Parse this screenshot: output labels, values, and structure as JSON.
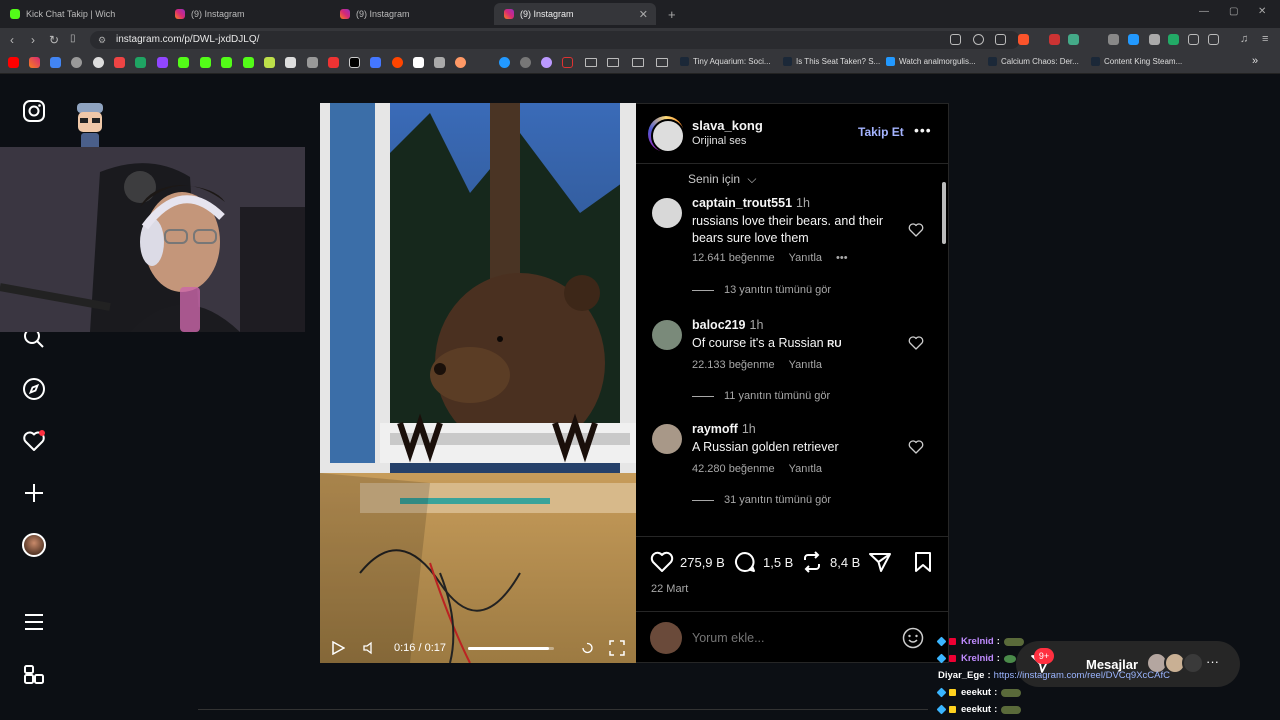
{
  "browser": {
    "tabs": [
      {
        "label": "Kick Chat Takip | Wich",
        "active": false
      },
      {
        "label": "(9) Instagram",
        "active": false
      },
      {
        "label": "(9) Instagram",
        "active": false
      },
      {
        "label": "(9) Instagram",
        "active": true
      }
    ],
    "new_tab": "+",
    "url": "instagram.com/p/DWL-jxdDJLQ/",
    "bookmarks": [
      "Tiny Aquarium: Soci...",
      "Is This Seat Taken? S...",
      "Watch analmorgulis...",
      "Calcium Chaos: Der...",
      "Content King Steam..."
    ],
    "bookmarks_more": "»"
  },
  "post": {
    "username": "slava_kong",
    "audio": "Orijinal ses",
    "follow_label": "Takip Et",
    "more": "•••",
    "sort_label": "Senin için",
    "comments": [
      {
        "user": "captain_trout551",
        "time": "1h",
        "text": "russians love their bears. and their bears sure love them",
        "likes": "12.641 beğenme",
        "reply": "Yanıtla",
        "more": "•••",
        "replies": "13 yanıtın tümünü gör"
      },
      {
        "user": "baloc219",
        "time": "1h",
        "text": "Of course it's a Russian",
        "flag": "RU",
        "likes": "22.133 beğenme",
        "reply": "Yanıtla",
        "replies": "11 yanıtın tümünü gör"
      },
      {
        "user": "raymoff",
        "time": "1h",
        "text": "A Russian golden retriever",
        "likes": "42.280 beğenme",
        "reply": "Yanıtla",
        "replies": "31 yanıtın tümünü gör"
      }
    ],
    "stats": {
      "likes": "275,9 B",
      "comments": "1,5 B",
      "reposts": "8,4 B"
    },
    "date": "22 Mart",
    "comment_placeholder": "Yorum ekle...",
    "video": {
      "time": "0:16 / 0:17",
      "progress": 0.94
    }
  },
  "messages": {
    "label": "Mesajlar",
    "badge": "9+"
  },
  "chat": [
    {
      "user": "Krelnid",
      "text": "",
      "color": "#c08bff"
    },
    {
      "user": "Krelnid",
      "text": "",
      "color": "#c08bff"
    },
    {
      "user": "Diyar_Ege",
      "text": "https://instagram.com/reel/DVCq9XcCAfC",
      "color": "#ffffff"
    },
    {
      "user": "eeekut",
      "text": "",
      "color": "#ffffff"
    },
    {
      "user": "eeekut",
      "text": "",
      "color": "#ffffff"
    }
  ],
  "colors": {
    "accent": "#a5b4ff",
    "notification": "#ff3040",
    "background": "#0c0f14"
  }
}
